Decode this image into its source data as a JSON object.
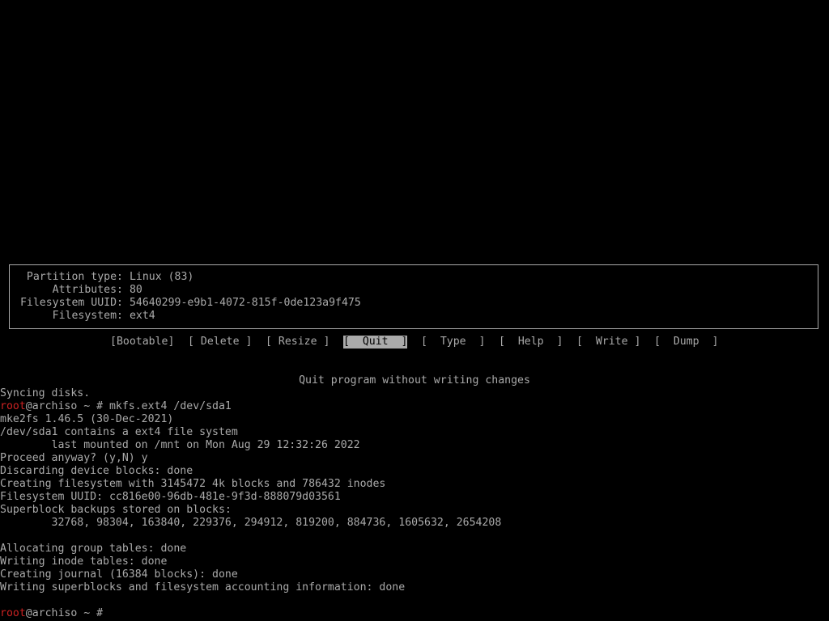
{
  "partition_info": {
    "type_label": "Partition type:",
    "type_value": "Linux (83)",
    "attributes_label": "Attributes:",
    "attributes_value": "80",
    "uuid_label": "Filesystem UUID:",
    "uuid_value": "54640299-e9b1-4072-815f-0de123a9f475",
    "filesystem_label": "Filesystem:",
    "filesystem_value": "ext4"
  },
  "menu": {
    "bootable": "[Bootable]",
    "delete": "[ Delete ]",
    "resize": "[ Resize ]",
    "quit": "[  Quit  ]",
    "type": "[  Type  ]",
    "help": "[  Help  ]",
    "write": "[  Write ]",
    "dump": "[  Dump  ]",
    "selected": "quit"
  },
  "hint": "Quit program without writing changes",
  "terminal": {
    "prompt_user": "root",
    "prompt_rest": "@archiso ~ #",
    "lines": [
      "Syncing disks.",
      " mkfs.ext4 /dev/sda1",
      "mke2fs 1.46.5 (30-Dec-2021)",
      "/dev/sda1 contains a ext4 file system",
      "        last mounted on /mnt on Mon Aug 29 12:32:26 2022",
      "Proceed anyway? (y,N) y",
      "Discarding device blocks: done",
      "Creating filesystem with 3145472 4k blocks and 786432 inodes",
      "Filesystem UUID: cc816e00-96db-481e-9f3d-888079d03561",
      "Superblock backups stored on blocks:",
      "        32768, 98304, 163840, 229376, 294912, 819200, 884736, 1605632, 2654208",
      "",
      "Allocating group tables: done",
      "Writing inode tables: done",
      "Creating journal (16384 blocks): done",
      "Writing superblocks and filesystem accounting information: done",
      "",
      " "
    ]
  }
}
